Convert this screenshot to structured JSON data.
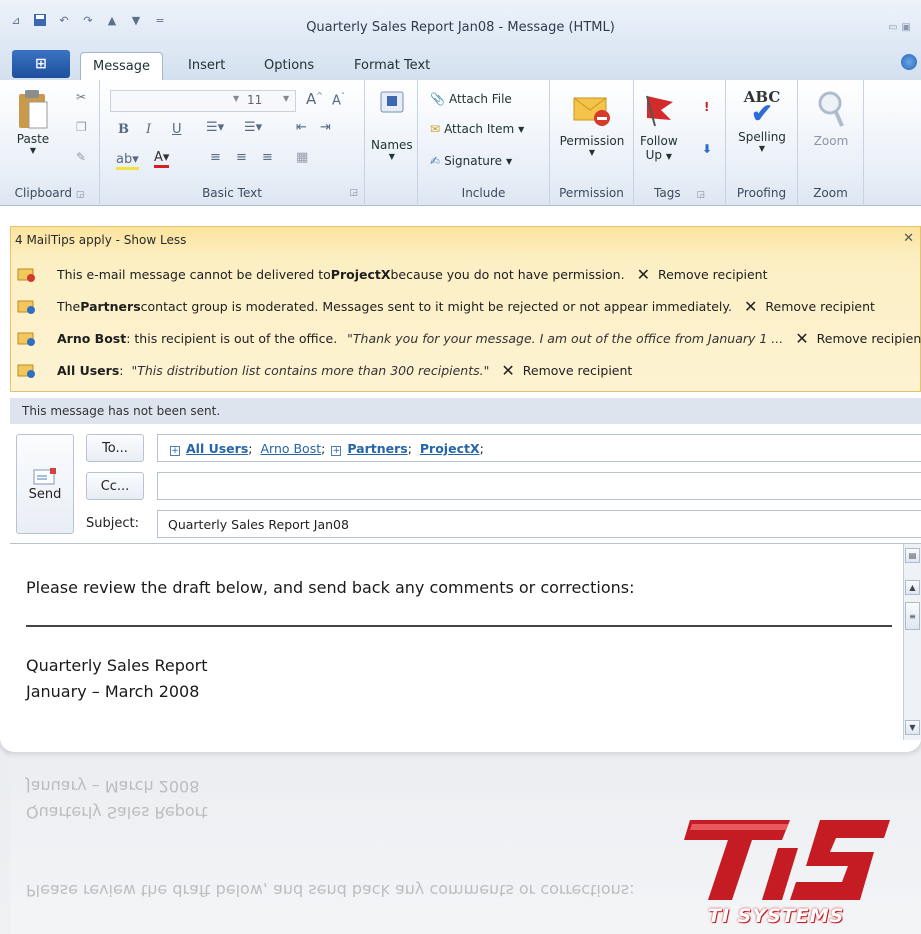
{
  "window": {
    "title": "Quarterly Sales Report Jan08  -  Message (HTML)",
    "tabs": [
      "Message",
      "Insert",
      "Options",
      "Format Text"
    ]
  },
  "ribbon": {
    "clipboard": {
      "paste": "Paste",
      "label": "Clipboard"
    },
    "basic_text": {
      "font_size": "11",
      "label": "Basic Text"
    },
    "names": {
      "label": "Names"
    },
    "include": {
      "attach_file": "Attach File",
      "attach_item": "Attach Item",
      "signature": "Signature",
      "label": "Include"
    },
    "permission": {
      "button": "Permission",
      "label": "Permission"
    },
    "tags": {
      "follow_up_1": "Follow",
      "follow_up_2": "Up",
      "label": "Tags"
    },
    "proofing": {
      "spelling": "Spelling",
      "label": "Proofing"
    },
    "zoom": {
      "button": "Zoom",
      "label": "Zoom"
    }
  },
  "mailtips": {
    "header": "4 MailTips apply  -  Show Less",
    "remove": "Remove recipient",
    "tip1": {
      "pre": "This e-mail message cannot be delivered to ",
      "bold": "ProjectX",
      "post": "because you do not have permission."
    },
    "tip2": {
      "pre": "The ",
      "bold": "Partners",
      "post": " contact group is moderated. Messages sent to it might be rejected or not appear immediately."
    },
    "tip3": {
      "bold": "Arno Bost",
      "post": ": this recipient is out of the office.",
      "quote": "\"Thank you for your message. I am out of the office from January 1 ..."
    },
    "tip4": {
      "bold": "All Users",
      "post": ":",
      "quote": "\"This distribution list contains more than 300 recipients.\""
    }
  },
  "status": {
    "not_sent": "This message has not been sent."
  },
  "compose": {
    "send": "Send",
    "to_button": "To...",
    "cc_button": "Cc...",
    "subject_label": "Subject:",
    "to": {
      "all_users": "All Users",
      "arno": "Arno Bost",
      "partners": "Partners",
      "projectx": "ProjectX"
    },
    "cc_value": "",
    "subject_value": "Quarterly Sales Report Jan08"
  },
  "body": {
    "line1": "Please review the draft below, and send back any comments or corrections:",
    "line2": "Quarterly Sales Report",
    "line3": "January – March 2008"
  },
  "logo": {
    "text": "TI SYSTEMS"
  },
  "colors": {
    "mailtip_bg": "#fcefc4",
    "link": "#2565a8",
    "logo_red": "#c41c22"
  }
}
